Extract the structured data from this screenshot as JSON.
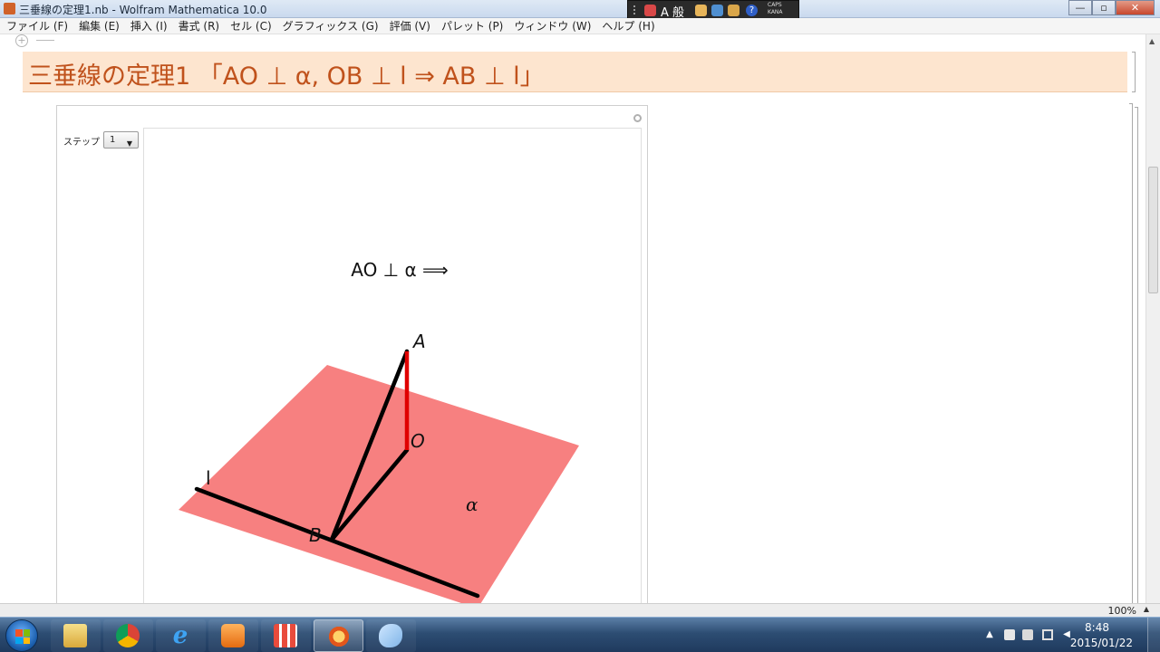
{
  "window": {
    "title": "三垂線の定理1.nb - Wolfram Mathematica 10.0",
    "buttons": {
      "minimize": "—",
      "maximize": "▫",
      "close": "✕"
    }
  },
  "ime_bar": {
    "mode_label": "A 般",
    "caps_label": "CAPS",
    "kana_label": "KANA",
    "help_label": "?"
  },
  "menubar": {
    "items": [
      "ファイル (F)",
      "編集 (E)",
      "挿入 (I)",
      "書式 (R)",
      "セル (C)",
      "グラフィックス (G)",
      "評価 (V)",
      "パレット (P)",
      "ウィンドウ (W)",
      "ヘルプ (H)"
    ]
  },
  "notebook": {
    "title_cell": "三垂線の定理1 「AO ⊥ α, OB ⊥ l  ⇒  AB ⊥ l」",
    "add_cell_symbol": "+",
    "manipulate": {
      "control_label": "ステップ",
      "control_value": "1",
      "caption": "AO ⊥ α ⟹",
      "plot": {
        "plane_color": "#f78080",
        "perpendicular_color": "#e00000",
        "line_color": "#000000",
        "point_labels": {
          "A": "A",
          "O": "O",
          "B": "B",
          "l": "l",
          "alpha": "α"
        }
      }
    }
  },
  "statusbar": {
    "zoom": "100%"
  },
  "taskbar": {
    "pinned": [
      "explorer-icon",
      "chrome-icon",
      "ie-icon",
      "media-player-icon",
      "app-grid-icon",
      "mathematica-icon",
      "paint-icon"
    ],
    "active": "mathematica-icon",
    "clock_time": "8:48",
    "clock_date": "2015/01/22"
  }
}
